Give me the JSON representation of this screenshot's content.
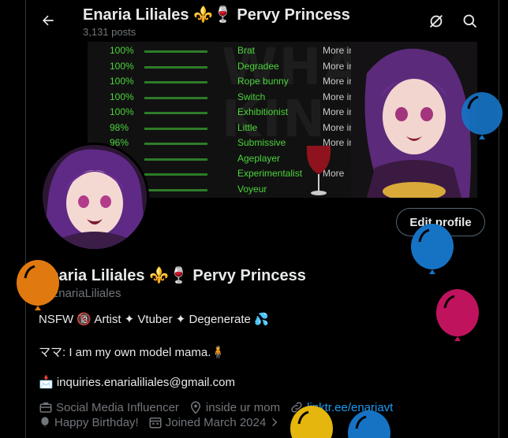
{
  "header": {
    "title": "Enaria Liliales ⚜️🍷 Pervy Princess",
    "posts": "3,131 posts"
  },
  "banner": {
    "bg_text": "WHA\nKIN DO",
    "kinks": [
      {
        "pct": "100%",
        "name": "Brat",
        "more": "More info"
      },
      {
        "pct": "100%",
        "name": "Degradee",
        "more": "More info"
      },
      {
        "pct": "100%",
        "name": "Rope bunny",
        "more": "More info"
      },
      {
        "pct": "100%",
        "name": "Switch",
        "more": "More info"
      },
      {
        "pct": "100%",
        "name": "Exhibitionist",
        "more": "More info"
      },
      {
        "pct": "98%",
        "name": "Little",
        "more": "More info"
      },
      {
        "pct": "96%",
        "name": "Submissive",
        "more": "More info"
      },
      {
        "pct": "",
        "name": "Ageplayer",
        "more": ""
      },
      {
        "pct": "",
        "name": "Experimentalist",
        "more": "More"
      },
      {
        "pct": "",
        "name": "Voyeur",
        "more": ""
      }
    ]
  },
  "profile": {
    "edit_label": "Edit profile",
    "name": "Enaria Liliales ⚜️🍷 Pervy Princess",
    "handle": "@EnariaLiliales",
    "bio_line1": "NSFW 🔞 Artist ✦ Vtuber ✦ Degenerate 💦",
    "bio_line2": "ママ: I am my own model mama.🧍",
    "bio_line3": "📩 inquiries.enarialiliales@gmail.com",
    "category": "Social Media Influencer",
    "location": "inside ur mom",
    "website": "linktr.ee/enariavt",
    "birthday": "Happy Birthday!",
    "joined": "Joined March 2024"
  },
  "colors": {
    "accent": "#1d9bf0",
    "muted": "#71767b",
    "balloon_blue": "#1673c4",
    "balloon_orange": "#e07a10",
    "balloon_magenta": "#c0135e",
    "balloon_yellow": "#e4b60e"
  }
}
